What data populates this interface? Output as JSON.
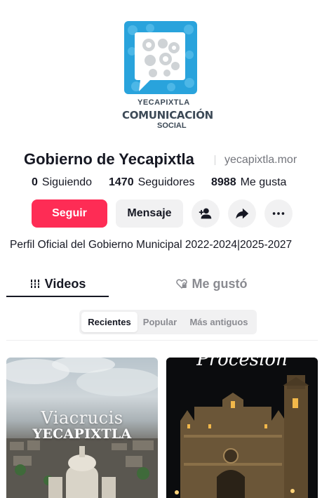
{
  "profile": {
    "logo_line1": "YECAPIXTLA",
    "logo_line2": "COMUNICACIÓN",
    "logo_line3": "SOCIAL",
    "display_name": "Gobierno de Yecapixtla",
    "username": "yecapixtla.mor",
    "bio": "Perfil Oficial del Gobierno Municipal 2022-2024|2025-2027",
    "brand_color": "#29a3dc"
  },
  "stats": [
    {
      "value": "0",
      "label": "Siguiendo"
    },
    {
      "value": "1470",
      "label": "Seguidores"
    },
    {
      "value": "8988",
      "label": "Me gusta"
    }
  ],
  "actions": {
    "follow_label": "Seguir",
    "message_label": "Mensaje",
    "follow_color": "#fe2c55",
    "icons": [
      "add-friend-icon",
      "share-icon",
      "more-icon"
    ]
  },
  "tabs": [
    {
      "label": "Videos",
      "icon": "grid-lines-icon",
      "active": true
    },
    {
      "label": "Me gustó",
      "icon": "heart-lock-icon",
      "active": false
    }
  ],
  "sort": {
    "options": [
      "Recientes",
      "Popular",
      "Más antiguos"
    ],
    "selected": "Recientes"
  },
  "videos": [
    {
      "title_line1": "Viacrucis",
      "title_line2": "YECAPIXTLA"
    },
    {
      "title": "Procesión"
    }
  ]
}
